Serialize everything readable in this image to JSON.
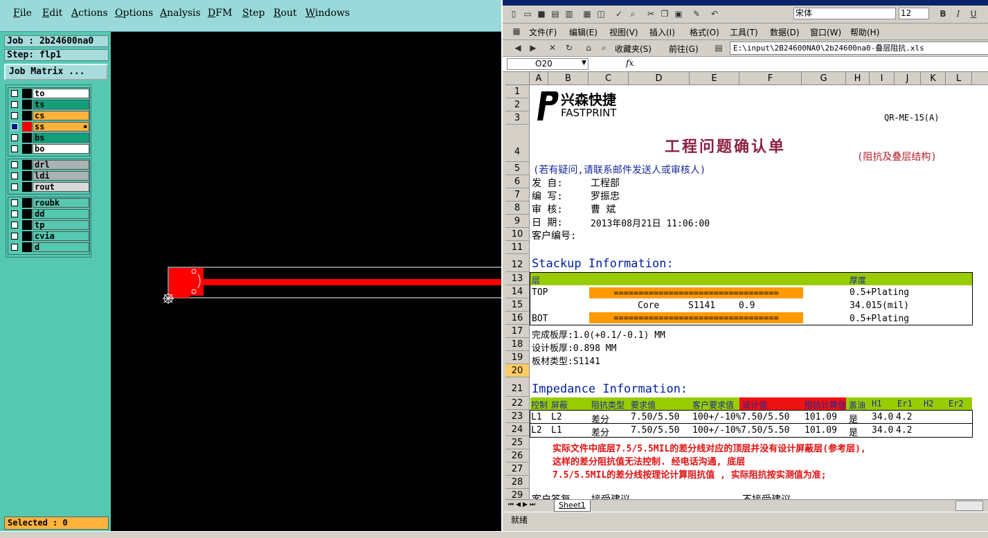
{
  "cam": {
    "menu": [
      "File",
      "Edit",
      "Actions",
      "Options",
      "Analysis",
      "DFM",
      "Step",
      "Rout",
      "Windows"
    ],
    "job": "Job : 2b24600na0",
    "step": "Step: flp1",
    "job_matrix": "Job Matrix ...",
    "layers_group1": [
      "to",
      "ts",
      "cs",
      "ss",
      "bs",
      "bo"
    ],
    "layers_group2": [
      "drl",
      "ldi",
      "rout"
    ],
    "layers_group3": [
      "roubk",
      "dd",
      "tp",
      "cvia",
      "d"
    ],
    "selected": "Selected : 0"
  },
  "excel": {
    "menu": [
      "文件(F)",
      "编辑(E)",
      "视图(V)",
      "插入(I)",
      "格式(O)",
      "工具(T)",
      "数据(D)",
      "窗口(W)",
      "帮助(H)"
    ],
    "font_name": "宋体",
    "font_size": "12",
    "favorites": "收藏夹(S)",
    "goto": "前往(G)",
    "path": "E:\\input\\2B24600NA0\\2b24600na0-叠层阻抗.xls",
    "namebox": "O20",
    "fx": "fx",
    "columns": [
      "A",
      "B",
      "C",
      "D",
      "E",
      "F",
      "G",
      "H",
      "I",
      "J",
      "K",
      "L"
    ],
    "rows": [
      "1",
      "2",
      "3",
      "4",
      "5",
      "6",
      "7",
      "8",
      "9",
      "10",
      "11",
      "12",
      "13",
      "14",
      "15",
      "16",
      "17",
      "18",
      "19",
      "20",
      "21",
      "22",
      "23",
      "24",
      "25",
      "26",
      "27",
      "28",
      "29"
    ],
    "logo_cn": "兴森快捷",
    "logo_en": "FASTPRINT",
    "form_code": "QR-ME-15(A)",
    "doc_title": "工程问题确认单",
    "doc_subtitle": "(阻抗及叠层结构)",
    "note": "(若有疑问,请联系邮件发送人或审核人)",
    "from_label": "发    自:",
    "from_val": "工程部",
    "author_label": "编    写:",
    "author_val": "罗振忠",
    "review_label": "审    核:",
    "review_val": "曹  斌",
    "date_label": "日    期:",
    "date_val": "2013年08月21日 11:06:00",
    "customer_no": "客户编号:",
    "stackup_title": "Stackup Information:",
    "stack_hdr_layer": "层",
    "stack_hdr_thick": "厚度",
    "stack_top": "TOP",
    "stack_top_thick": "0.5+Plating",
    "stack_bars": "=================================",
    "core_label": "Core",
    "core_mat": "S1141",
    "core_val": "0.9",
    "core_thick": "34.015(mil)",
    "stack_bot": "BOT",
    "stack_bot_thick": "0.5+Plating",
    "finish_thick": "完成板厚:1.0(+0.1/-0.1) MM",
    "design_thick": "设计板厚:0.898 MM",
    "board_type": "板材类型:S1141",
    "imp_title": "Impedance Information:",
    "imp_headers": [
      "控制",
      "屏蔽",
      "阻抗类型",
      "要求值",
      "客户要求值",
      "设计值",
      "阻抗计算值",
      "盖油",
      "H1",
      "Er1",
      "H2",
      "Er2"
    ],
    "imp_rows": [
      [
        "L1",
        "L2",
        "差分",
        "7.50/5.50",
        "100+/-10%",
        "7.50/5.50",
        "101.09",
        "是",
        "34.0",
        "4.2"
      ],
      [
        "L2",
        "L1",
        "差分",
        "7.50/5.50",
        "100+/-10%",
        "7.50/5.50",
        "101.09",
        "是",
        "34.0",
        "4.2"
      ]
    ],
    "remark1": "实际文件中底层7.5/5.5MIL的差分线对应的顶层并没有设计屏蔽层(参考层),",
    "remark2": "这样的差分阻抗值无法控制. 经电话沟通, 底层",
    "remark3": "7.5/5.5MIL的差分线按理论计算阻抗值 , 实际阻抗按实测值为准;",
    "row29a": "客户答复",
    "row29b": "接受建议",
    "row29c": "不接受建议",
    "sheet_tab": "Sheet1",
    "status": "就绪"
  },
  "colors": {
    "cam_menu": "#99d9d9",
    "cam_panel": "#55c8b0",
    "accent_orange": "#ffb23c",
    "excel_green": "#99cc00",
    "trace_red": "#ff0000"
  }
}
